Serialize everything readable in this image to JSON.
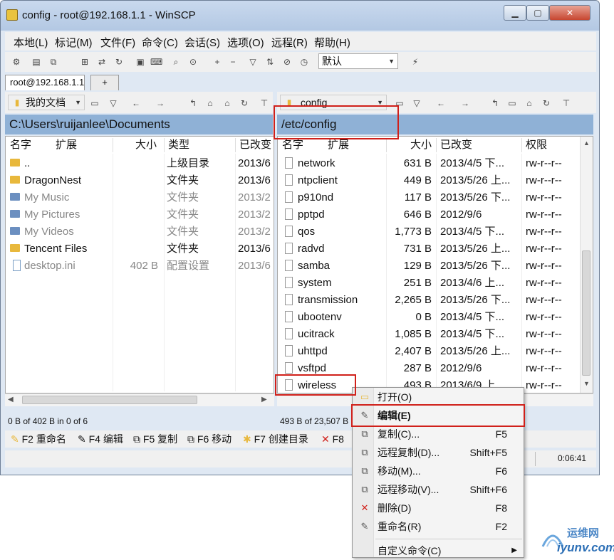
{
  "window": {
    "title": "config - root@192.168.1.1 - WinSCP",
    "min": "▁",
    "max": "▢",
    "close": "✕"
  },
  "menu": [
    "本地(L)",
    "标记(M)",
    "文件(F)",
    "命令(C)",
    "会话(S)",
    "选项(O)",
    "远程(R)",
    "帮助(H)"
  ],
  "toolbar": {
    "transfer_setting": "默认"
  },
  "tabs": {
    "session": "root@192.168.1.1",
    "new": "+"
  },
  "local": {
    "location": "我的文档",
    "path": "C:\\Users\\ruijanlee\\Documents",
    "headers": {
      "name": "名字",
      "ext": "扩展",
      "size": "大小",
      "type": "类型",
      "changed": "已改变"
    },
    "rows": [
      {
        "name": "..",
        "size": "",
        "type": "上级目录",
        "changed": "2013/6",
        "icon": "folder-up",
        "dim": false
      },
      {
        "name": "DragonNest",
        "size": "",
        "type": "文件夹",
        "changed": "2013/6",
        "icon": "folder",
        "dim": false
      },
      {
        "name": "My Music",
        "size": "",
        "type": "文件夹",
        "changed": "2013/2",
        "icon": "folder",
        "dim": true
      },
      {
        "name": "My Pictures",
        "size": "",
        "type": "文件夹",
        "changed": "2013/2",
        "icon": "folder",
        "dim": true
      },
      {
        "name": "My Videos",
        "size": "",
        "type": "文件夹",
        "changed": "2013/2",
        "icon": "folder",
        "dim": true
      },
      {
        "name": "Tencent Files",
        "size": "",
        "type": "文件夹",
        "changed": "2013/6",
        "icon": "folder",
        "dim": false
      },
      {
        "name": "desktop.ini",
        "size": "402 B",
        "type": "配置设置",
        "changed": "2013/6",
        "icon": "settings-file",
        "dim": true
      }
    ],
    "status": "0 B of 402 B in 0 of 6"
  },
  "remote": {
    "location": "config",
    "path": "/etc/config",
    "headers": {
      "name": "名字",
      "ext": "扩展",
      "size": "大小",
      "changed": "已改变",
      "rights": "权限"
    },
    "rows": [
      {
        "name": "network",
        "size": "631 B",
        "changed": "2013/4/5 下...",
        "rights": "rw-r--r--"
      },
      {
        "name": "ntpclient",
        "size": "449 B",
        "changed": "2013/5/26 上...",
        "rights": "rw-r--r--"
      },
      {
        "name": "p910nd",
        "size": "117 B",
        "changed": "2013/5/26 下...",
        "rights": "rw-r--r--"
      },
      {
        "name": "pptpd",
        "size": "646 B",
        "changed": "2012/9/6",
        "rights": "rw-r--r--"
      },
      {
        "name": "qos",
        "size": "1,773 B",
        "changed": "2013/4/5 下...",
        "rights": "rw-r--r--"
      },
      {
        "name": "radvd",
        "size": "731 B",
        "changed": "2013/5/26 上...",
        "rights": "rw-r--r--"
      },
      {
        "name": "samba",
        "size": "129 B",
        "changed": "2013/5/26 下...",
        "rights": "rw-r--r--"
      },
      {
        "name": "system",
        "size": "251 B",
        "changed": "2013/4/6 上...",
        "rights": "rw-r--r--"
      },
      {
        "name": "transmission",
        "size": "2,265 B",
        "changed": "2013/5/26 下...",
        "rights": "rw-r--r--"
      },
      {
        "name": "ubootenv",
        "size": "0 B",
        "changed": "2013/4/5 下...",
        "rights": "rw-r--r--"
      },
      {
        "name": "ucitrack",
        "size": "1,085 B",
        "changed": "2013/4/5 下...",
        "rights": "rw-r--r--"
      },
      {
        "name": "uhttpd",
        "size": "2,407 B",
        "changed": "2013/5/26 上...",
        "rights": "rw-r--r--"
      },
      {
        "name": "vsftpd",
        "size": "287 B",
        "changed": "2012/9/6",
        "rights": "rw-r--r--"
      },
      {
        "name": "wireless",
        "size": "493 B",
        "changed": "2013/6/9 上...",
        "rights": "rw-r--r--"
      }
    ],
    "status": "493 B of 23,507 B"
  },
  "fkeys": [
    "F2 重命名",
    "F4 编辑",
    "F5 复制",
    "F6 移动",
    "F7 创建目录",
    "F8"
  ],
  "timer": "0:06:41",
  "context_menu": [
    {
      "label": "打开(O)",
      "shortcut": "",
      "icon": "open-folder-icon"
    },
    {
      "label": "编辑(E)",
      "shortcut": "",
      "icon": "edit-icon",
      "bold": true
    },
    {
      "label": "复制(C)...",
      "shortcut": "F5",
      "icon": "copy-icon"
    },
    {
      "label": "远程复制(D)...",
      "shortcut": "Shift+F5",
      "icon": "remote-copy-icon"
    },
    {
      "label": "移动(M)...",
      "shortcut": "F6",
      "icon": "move-icon"
    },
    {
      "label": "远程移动(V)...",
      "shortcut": "Shift+F6",
      "icon": "remote-move-icon"
    },
    {
      "label": "删除(D)",
      "shortcut": "F8",
      "icon": "delete-icon"
    },
    {
      "label": "重命名(R)",
      "shortcut": "F2",
      "icon": "rename-icon"
    },
    {
      "label": "自定义命令(C)",
      "shortcut": "",
      "icon": "custom-command-icon",
      "submenu": true
    }
  ],
  "watermark": {
    "cn": "运维网",
    "url": "iyunv.com"
  },
  "colors": {
    "path_bar": "#8fb1d6",
    "highlight": "#d0201a",
    "folder": "#e8b83c"
  }
}
